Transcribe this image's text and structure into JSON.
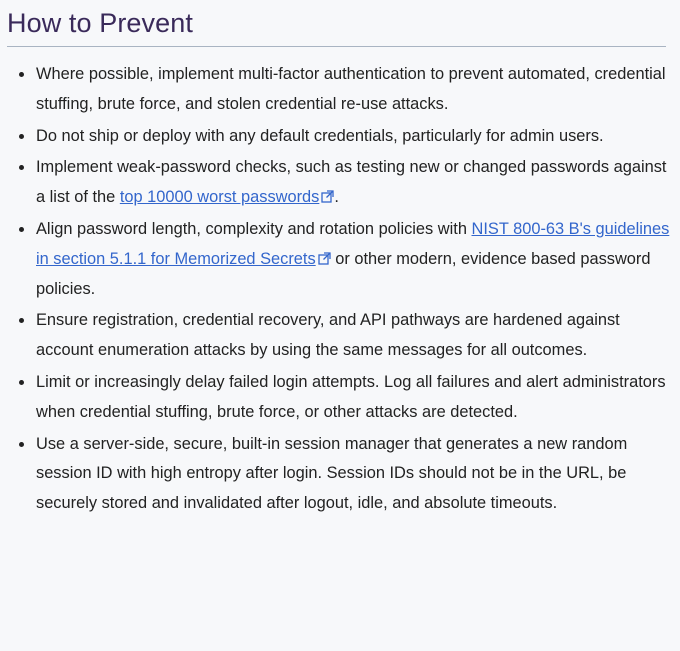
{
  "section": {
    "title": "How to Prevent"
  },
  "items": {
    "0": {
      "text": "Where possible, implement multi-factor authentication to prevent automated, credential stuffing, brute force, and stolen credential re-use attacks."
    },
    "1": {
      "text": "Do not ship or deploy with any default credentials, particularly for admin users."
    },
    "2": {
      "before": "Implement weak-password checks, such as testing new or changed passwords against a list of the ",
      "link": "top 10000 worst passwords",
      "after": "."
    },
    "3": {
      "before": "Align password length, complexity and rotation policies with ",
      "link": "NIST 800-63 B's guidelines in section 5.1.1 for Memorized Secrets",
      "after": " or other modern, evidence based password policies."
    },
    "4": {
      "text": "Ensure registration, credential recovery, and API pathways are hardened against account enumeration attacks by using the same messages for all outcomes."
    },
    "5": {
      "text": "Limit or increasingly delay failed login attempts. Log all failures and alert administrators when credential stuffing, brute force, or other attacks are detected."
    },
    "6": {
      "text": "Use a server-side, secure, built-in session manager that generates a new random session ID with high entropy after login. Session IDs should not be in the URL, be securely stored and invalidated after logout, idle, and absolute timeouts."
    }
  },
  "icons": {
    "external_link": "external-link-icon"
  },
  "colors": {
    "heading": "#3a2a5a",
    "link": "#3366cc",
    "text": "#222222",
    "background": "#f7f8fa"
  }
}
